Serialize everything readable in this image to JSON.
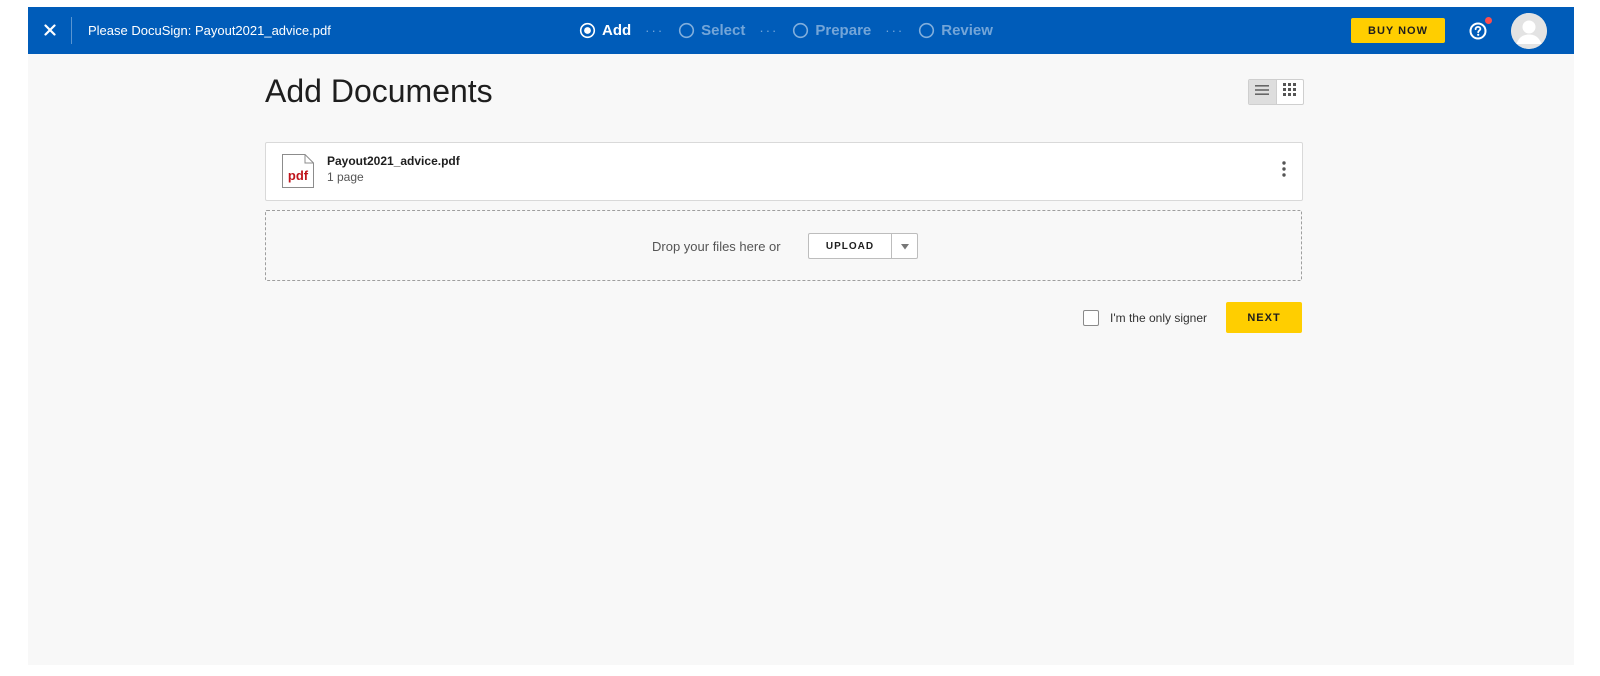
{
  "topbar": {
    "title": "Please DocuSign: Payout2021_advice.pdf",
    "close_icon": "close-icon",
    "steps": [
      {
        "label": "Add",
        "state": "active"
      },
      {
        "label": "Select",
        "state": "inactive"
      },
      {
        "label": "Prepare",
        "state": "inactive"
      },
      {
        "label": "Review",
        "state": "inactive"
      }
    ],
    "step_separator": "···",
    "buy_now_label": "BUY NOW",
    "help_icon": "help-icon",
    "notification_color": "#ff4d4d",
    "avatar_icon": "user-avatar-icon",
    "bar_color": "#005cb9"
  },
  "main": {
    "page_title": "Add Documents",
    "view_toggle": {
      "list_icon": "list-view-icon",
      "grid_icon": "grid-view-icon",
      "selected": "list"
    },
    "documents": [
      {
        "icon": "pdf-file-icon",
        "icon_text": "pdf",
        "name": "Payout2021_advice.pdf",
        "pages": "1 page",
        "menu_icon": "more-vertical-icon"
      }
    ],
    "dropzone": {
      "text": "Drop your files here or",
      "upload_label": "UPLOAD",
      "caret_icon": "caret-down-icon"
    },
    "only_signer_label": "I'm the only signer",
    "only_signer_checked": false,
    "next_label": "NEXT",
    "accent_color": "#ffce00"
  }
}
